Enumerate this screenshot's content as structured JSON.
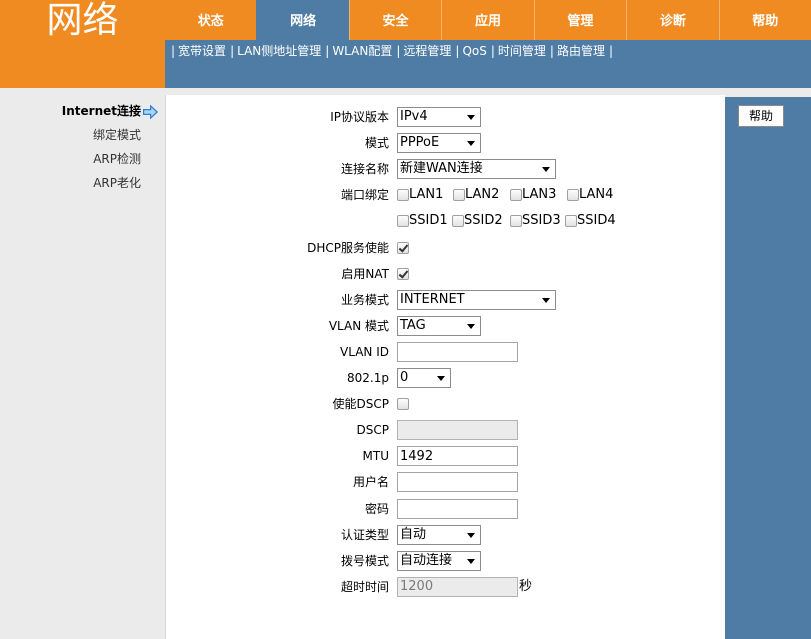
{
  "theme": {
    "header_orange": "#f08b22",
    "nav_blue": "#4f7ca5",
    "arrow_blue": "#2e7fcf"
  },
  "icons": {
    "sidebar_active": "arrow-right-icon",
    "select": "dropdown-arrow-icon",
    "checkbox_checked": "checkmark-icon"
  },
  "brand": {
    "title": "网络"
  },
  "nav": {
    "tabs": [
      {
        "label": "状态",
        "active": false
      },
      {
        "label": "网络",
        "active": true
      },
      {
        "label": "安全",
        "active": false
      },
      {
        "label": "应用",
        "active": false
      },
      {
        "label": "管理",
        "active": false
      },
      {
        "label": "诊断",
        "active": false
      },
      {
        "label": "帮助",
        "active": false
      }
    ]
  },
  "subnav": {
    "separator": "|",
    "items": [
      "宽带设置",
      "LAN侧地址管理",
      "WLAN配置",
      "远程管理",
      "QoS",
      "时间管理",
      "路由管理"
    ]
  },
  "sidebar": {
    "items": [
      {
        "label": "Internet连接",
        "active": true
      },
      {
        "label": "绑定模式",
        "active": false
      },
      {
        "label": "ARP检测",
        "active": false
      },
      {
        "label": "ARP老化",
        "active": false
      }
    ]
  },
  "form": {
    "ip_version": {
      "label": "IP协议版本",
      "value": "IPv4"
    },
    "mode": {
      "label": "模式",
      "value": "PPPoE"
    },
    "connection_name": {
      "label": "连接名称",
      "value": "新建WAN连接"
    },
    "port_binding": {
      "label": "端口绑定",
      "lan": [
        {
          "label": "LAN1",
          "checked": false
        },
        {
          "label": "LAN2",
          "checked": false
        },
        {
          "label": "LAN3",
          "checked": false
        },
        {
          "label": "LAN4",
          "checked": false
        }
      ],
      "ssid": [
        {
          "label": "SSID1",
          "checked": false
        },
        {
          "label": "SSID2",
          "checked": false
        },
        {
          "label": "SSID3",
          "checked": false
        },
        {
          "label": "SSID4",
          "checked": false
        }
      ]
    },
    "dhcp_enable": {
      "label": "DHCP服务使能",
      "checked": true
    },
    "nat_enable": {
      "label": "启用NAT",
      "checked": true
    },
    "service_mode": {
      "label": "业务模式",
      "value": "INTERNET"
    },
    "vlan_mode": {
      "label": "VLAN 模式",
      "value": "TAG"
    },
    "vlan_id": {
      "label": "VLAN ID",
      "value": ""
    },
    "priority_8021p": {
      "label": "802.1p",
      "value": "0"
    },
    "dscp_enable": {
      "label": "使能DSCP",
      "checked": false
    },
    "dscp": {
      "label": "DSCP",
      "value": "",
      "disabled": true
    },
    "mtu": {
      "label": "MTU",
      "value": "1492"
    },
    "username": {
      "label": "用户名",
      "value": ""
    },
    "password": {
      "label": "密码",
      "value": ""
    },
    "auth_type": {
      "label": "认证类型",
      "value": "自动"
    },
    "dial_mode": {
      "label": "拨号模式",
      "value": "自动连接"
    },
    "idle_timeout": {
      "label": "超时时间",
      "value": "1200",
      "unit": "秒",
      "disabled": true
    }
  },
  "help": {
    "button_label": "帮助"
  }
}
